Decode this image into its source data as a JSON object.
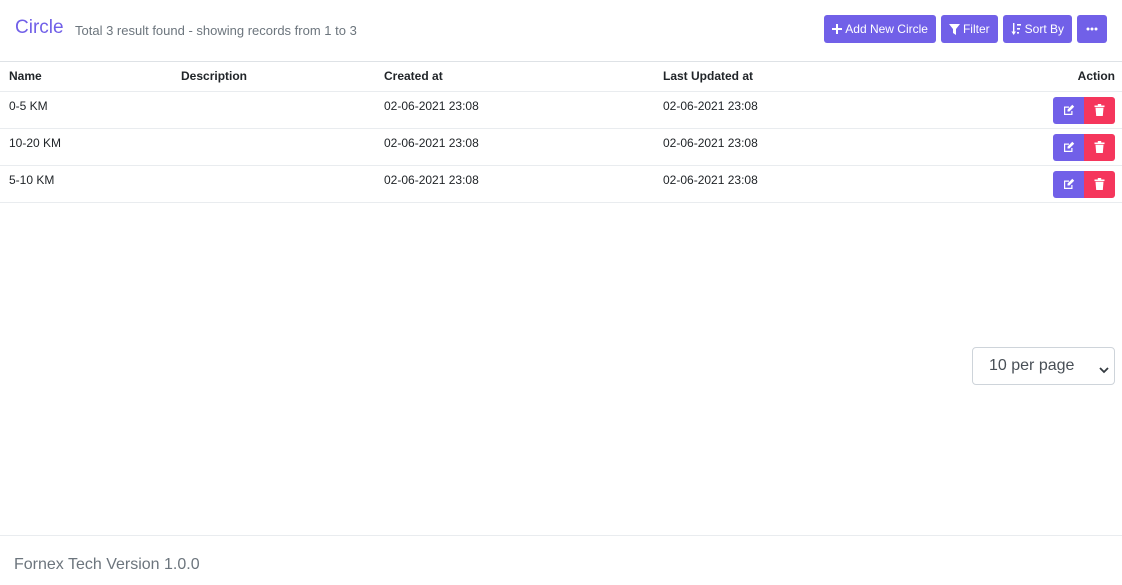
{
  "page": {
    "title": "Circle",
    "summary": "Total 3 result found - showing records from 1 to 3"
  },
  "toolbar": {
    "add_label": "Add New Circle",
    "filter_label": "Filter",
    "sort_label": "Sort By",
    "more_icon": "ellipsis-icon"
  },
  "table": {
    "columns": [
      "Name",
      "Description",
      "Created at",
      "Last Updated at",
      "Action"
    ],
    "rows": [
      {
        "name": "0-5 KM",
        "description": "",
        "created_at": "02-06-2021 23:08",
        "updated_at": "02-06-2021 23:08"
      },
      {
        "name": "10-20 KM",
        "description": "",
        "created_at": "02-06-2021 23:08",
        "updated_at": "02-06-2021 23:08"
      },
      {
        "name": "5-10 KM",
        "description": "",
        "created_at": "02-06-2021 23:08",
        "updated_at": "02-06-2021 23:08"
      }
    ]
  },
  "pagination": {
    "per_page_label": "10 per page"
  },
  "footer": {
    "text": "Fornex Tech Version 1.0.0"
  },
  "colors": {
    "accent": "#7160e8",
    "danger": "#f5365c"
  }
}
